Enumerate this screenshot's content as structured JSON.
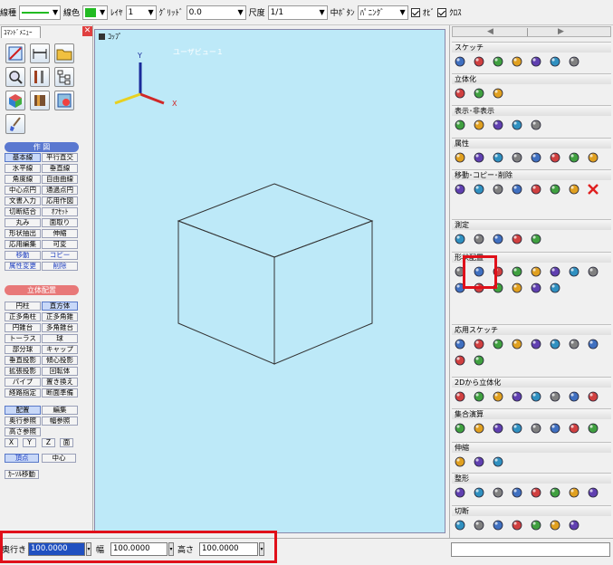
{
  "toolbar": {
    "line_type_label": "線種",
    "line_color_label": "線色",
    "line_color": "#22bb22",
    "layer_label": "ﾚｲﾔ",
    "layer_value": "1",
    "grid_label": "ｸﾞﾘｯﾄﾞ",
    "grid_value": "0.0",
    "scale_label": "尺度",
    "scale_value": "1/1",
    "middle_button_label": "中ﾎﾞﾀﾝ",
    "middle_button_value": "ﾊﾟﾆﾝｸﾞ",
    "snap_label": "ｵﾋﾞ",
    "cross_label": "ｸﾛｽ"
  },
  "left_panel": {
    "tab_label": "ｺﾏﾝﾄﾞﾒﾆｭｰ",
    "close_icon": "close-icon",
    "section_draw": "作 図",
    "draw_buttons": [
      [
        "基本線",
        "平行直交"
      ],
      [
        "水平線",
        "垂直線"
      ],
      [
        "角度線",
        "自由曲線"
      ],
      [
        "中心点円",
        "通過点円"
      ],
      [
        "文書入力",
        "応用作図"
      ],
      [
        "切断結合",
        "ｵﾌｾｯﾄ"
      ],
      [
        "丸み",
        "面取り"
      ],
      [
        "形状抽出",
        "伸縮"
      ],
      [
        "応用編集",
        "可変"
      ],
      [
        "移動",
        "コピー"
      ],
      [
        "属性変更",
        "削除"
      ]
    ],
    "section_solid": "立体配置",
    "solid_buttons": [
      [
        "円柱",
        "直方体"
      ],
      [
        "正多角柱",
        "正多角錐"
      ],
      [
        "円錐台",
        "多角錐台"
      ],
      [
        "トーラス",
        "球"
      ],
      [
        "部分球",
        "キャップ"
      ],
      [
        "垂直投影",
        "傾心投影"
      ],
      [
        "拡張投影",
        "回転体"
      ],
      [
        "パイプ",
        "置き換え"
      ],
      [
        "経路指定",
        "断面準備"
      ]
    ],
    "layout_buttons": [
      [
        "配置",
        "編集"
      ],
      [
        "奥行参照",
        "幅参照"
      ]
    ],
    "height_ref": "高さ参照",
    "axis_buttons": [
      "X",
      "Y",
      "Z",
      "面"
    ],
    "point_buttons": [
      "頂点",
      "中心"
    ],
    "cursor_move": "ｶｰｿﾙ移動"
  },
  "viewport": {
    "title": "ｺｯﾌﾟ",
    "view_name": "ユーザビュー１",
    "axis_x": "X",
    "axis_y": "Y"
  },
  "right_panel": {
    "sections": [
      "スケッチ",
      "立体化",
      "表示･非表示",
      "属性",
      "移動･コピー･削除",
      "測定",
      "形状配置",
      "応用スケッチ",
      "2Dから立体化",
      "集合演算",
      "伸縮",
      "整形",
      "切断"
    ]
  },
  "bottom": {
    "depth_label": "奥行き",
    "depth_value": "100.0000",
    "width_label": "幅",
    "width_value": "100.0000",
    "height_label": "高さ",
    "height_value": "100.0000"
  }
}
